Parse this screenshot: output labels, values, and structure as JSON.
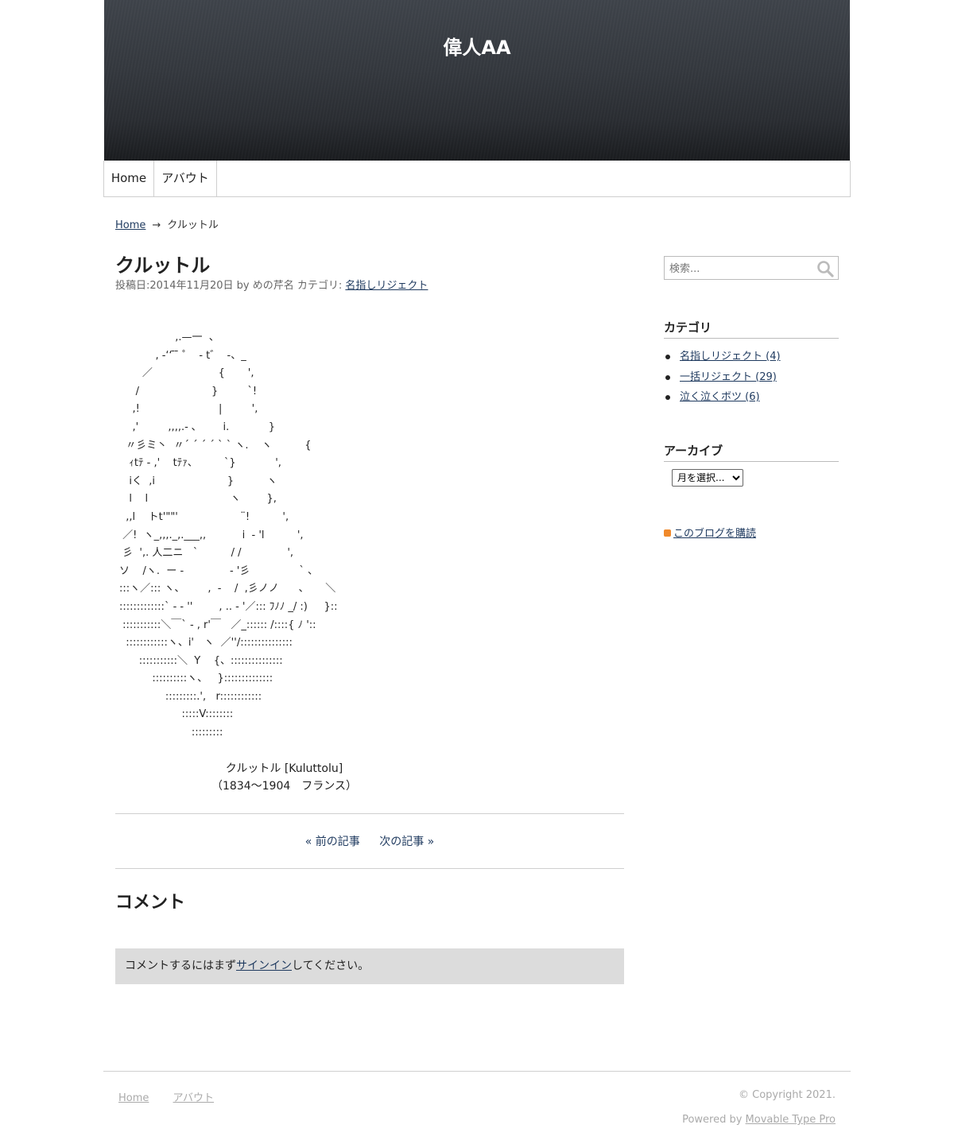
{
  "site": {
    "title": "偉人AA"
  },
  "nav": {
    "home": "Home",
    "about": "アバウト"
  },
  "breadcrumb": {
    "home": "Home",
    "arrow": "→",
    "current": "クルットル"
  },
  "post": {
    "title": "クルットル",
    "meta_prefix": "投稿日:2014年11月20日 by めの芹名 カテゴリ: ",
    "category": "名指しリジェクト",
    "aa": "                 ,.—一  、\n           , -‘‘ ̄ ̄ ゜  - t゛  -、_\n       ／                    {       ',\n     /                      }         `!\n    ,!                        |         ',\n    ,'         ,,,,.- ､        i.            }\n  〃彡ミ丶  〃´ ´ ´ ´ ` ` ヽ.    ヽ          {\n   ｨtﾃ - ,'    tﾃｧ、        `}            ',\n   iく  ,i                      }          ヽ\n   l    l                         ヽ        },\n  ,,l    トt'\"\"'                   ¨!          ',\n ／!  ヽ_,,,._,.___,,           i  - 'l          ',\n 彡  ',. 人二ニ   `          / /              ',\nソ    /ヽ.  ー -              - '彡               ` 、\n:::ヽ／::: ヽ、       ,  -    /  ,彡ノノ      、     ＼\n:::::::::::::` - - ''        , .. - '／::: ﾌﾉﾉ _/ :)     }::\n :::::::::::＼￣` - , r'￣   ／_:::::: /::::{ ﾉ '::\n  ::::::::::::ヽ、i'   ヽ  ／''/:::::::::::::::\n      :::::::::::＼  Y    {、:::::::::::::::\n          ::::::::::ヽ、   }::::::::::::::\n              :::::::::.',   r::::::::::::\n                   :::::V::::::::\n                      :::::::::",
    "caption_name": "クルットル [Kuluttolu]",
    "caption_years": "（1834～1904　フランス）"
  },
  "pager": {
    "prev": "« 前の記事",
    "next": "次の記事 »"
  },
  "comments": {
    "title": "コメント",
    "signin_before": "コメントするにはまず",
    "signin_link": "サインイン",
    "signin_after": "してください。"
  },
  "sidebar": {
    "search_placeholder": "検索...",
    "categories_title": "カテゴリ",
    "categories": [
      "名指しリジェクト (4)",
      "一括リジェクト (29)",
      "泣く泣くボツ (6)"
    ],
    "archive_title": "アーカイブ",
    "archive_select": "月を選択...",
    "feed_label": "このブログを購読"
  },
  "footer": {
    "home": "Home",
    "about": "アバウト",
    "copyright": "© Copyright 2021.",
    "powered_prefix": "Powered by ",
    "powered_link": "Movable Type Pro"
  },
  "colors": {
    "link": "#1f3a5f",
    "header_bg": "#2a2d32",
    "notice_bg": "#dcdcdc",
    "feed_icon": "#f0892b"
  }
}
